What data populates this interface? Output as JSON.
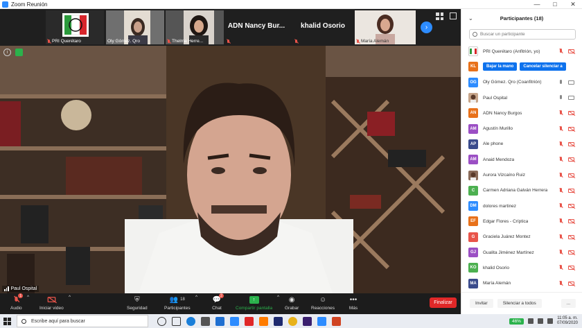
{
  "window": {
    "title": "Zoom Reunión",
    "minimize": "—",
    "maximize": "□",
    "close": "✕"
  },
  "thumbnails": [
    {
      "name": "PRI Querétaro"
    },
    {
      "name": "Oly Gómez. Qro"
    },
    {
      "name": "Thelma Herre..."
    },
    {
      "display": "ADN Nancy Bur..."
    },
    {
      "display": "khalid Osorio"
    },
    {
      "name": "María Alemán"
    }
  ],
  "speaker": {
    "name": "Paul Ospital",
    "info": "i"
  },
  "controls": {
    "audio": "Audio",
    "video": "Iniciar video",
    "security": "Seguridad",
    "participants": "Participantes",
    "participants_count": "18",
    "chat": "Chat",
    "chat_badge": "2",
    "audio_badge": "1",
    "share": "Compartir pantalla",
    "record": "Grabar",
    "reactions": "Reacciones",
    "more": "Más",
    "end": "Finalizar"
  },
  "panel": {
    "title": "Participantes (18)",
    "search_placeholder": "Buscar un participante",
    "lower_hand": "Bajar la mano",
    "cancel_unmute": "Cancelar silenciar a",
    "invite": "Invitar",
    "mute_all": "Silenciar a todos",
    "more": "..."
  },
  "participants": [
    {
      "initials": "",
      "name": "PRI Querétaro (Anfitrión, yo)",
      "color": "#ffffff",
      "photo": "logo",
      "mic": "off",
      "cam": "off"
    },
    {
      "initials": "KL",
      "name": "",
      "color": "#e8711a",
      "mic": "",
      "cam": ""
    },
    {
      "initials": "OG",
      "name": "Oly Gómez. Qro (Coanfitrión)",
      "color": "#2d8cff",
      "mic": "on",
      "cam": "on"
    },
    {
      "initials": "",
      "name": "Paul Ospital",
      "color": "#c7a58a",
      "photo": "face",
      "mic": "on",
      "cam": "on"
    },
    {
      "initials": "AN",
      "name": "ADN Nancy Burgos",
      "color": "#e8711a",
      "mic": "off",
      "cam": "off"
    },
    {
      "initials": "AM",
      "name": "Agustín Murillo",
      "color": "#9b4fc4",
      "mic": "off",
      "cam": "off"
    },
    {
      "initials": "AP",
      "name": "Ale phone",
      "color": "#3a4b8c",
      "mic": "off",
      "cam": "off"
    },
    {
      "initials": "AM",
      "name": "Anaid Mendoza",
      "color": "#9b4fc4",
      "mic": "off",
      "cam": "off"
    },
    {
      "initials": "",
      "name": "Aurora Vizcaíno Ruiz",
      "color": "#8a6b5a",
      "photo": "face",
      "mic": "off",
      "cam": "off"
    },
    {
      "initials": "C",
      "name": "Carmen Adriana Galván Herrera",
      "color": "#4cb050",
      "mic": "off",
      "cam": "off"
    },
    {
      "initials": "DM",
      "name": "dolores martinez",
      "color": "#2d8cff",
      "mic": "off",
      "cam": "off"
    },
    {
      "initials": "EF",
      "name": "Edgar Flores - Críptica",
      "color": "#e8711a",
      "mic": "off",
      "cam": "off"
    },
    {
      "initials": "G",
      "name": "Graciela Juárez Montez",
      "color": "#e8544a",
      "mic": "off",
      "cam": "off"
    },
    {
      "initials": "GJ",
      "name": "Gualita Jiménez Martínez",
      "color": "#9b4fc4",
      "mic": "off",
      "cam": "off"
    },
    {
      "initials": "KO",
      "name": "khalid Osorio",
      "color": "#4cb050",
      "mic": "off",
      "cam": "off"
    },
    {
      "initials": "MA",
      "name": "María Alemán",
      "color": "#3a4b8c",
      "mic": "off",
      "cam": "off"
    }
  ],
  "taskbar": {
    "search": "Escribe aquí para buscar",
    "battery": "46%",
    "time": "11:05 a. m.",
    "date": "07/09/2020"
  },
  "colors": {
    "accent": "#2d8cff",
    "end": "#e02828",
    "share": "#2bb24c",
    "muted": "#e8544a"
  }
}
